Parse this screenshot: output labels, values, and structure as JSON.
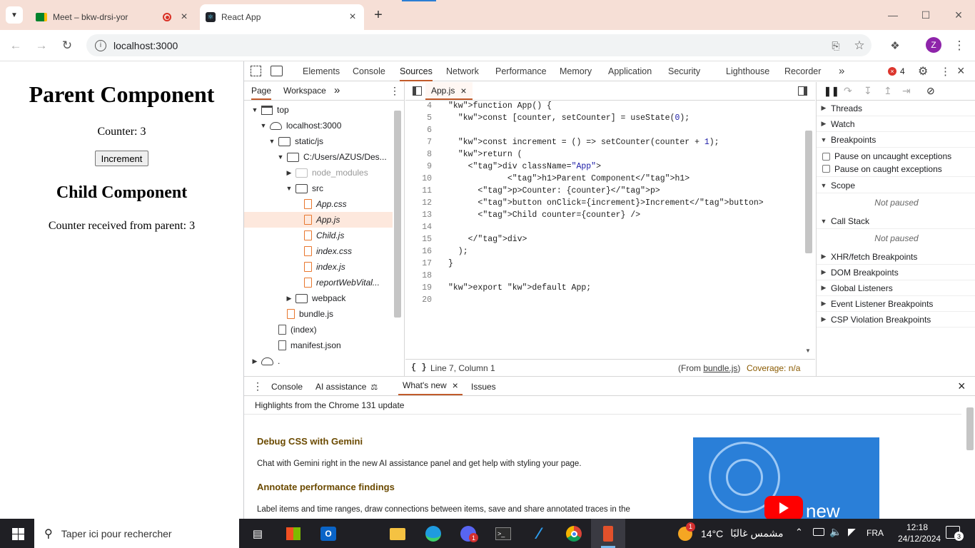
{
  "browser": {
    "tabs": [
      {
        "title": "Meet – bkw-drsi-yor",
        "icon": "google-meet-icon"
      },
      {
        "title": "React App",
        "icon": "react-icon"
      }
    ],
    "new_tab": "+",
    "url": "localhost:3000",
    "profile_initial": "Z"
  },
  "page": {
    "h1": "Parent Component",
    "counter_text": "Counter: 3",
    "button_label": "Increment",
    "h2": "Child Component",
    "child_text": "Counter received from parent: 3"
  },
  "devtools": {
    "tabs": [
      "Elements",
      "Console",
      "Sources",
      "Network",
      "Performance",
      "Memory",
      "Application",
      "Security",
      "Lighthouse",
      "Recorder"
    ],
    "active_tab": "Sources",
    "error_count": "4",
    "navigator_tabs": [
      "Page",
      "Workspace"
    ],
    "tree": [
      {
        "label": "top",
        "depth": 0,
        "kind": "frame",
        "open": true
      },
      {
        "label": "localhost:3000",
        "depth": 1,
        "kind": "cloud",
        "open": true
      },
      {
        "label": "static/js",
        "depth": 2,
        "kind": "folder",
        "open": true
      },
      {
        "label": "C:/Users/AZUS/Des...",
        "depth": 3,
        "kind": "folder",
        "open": true
      },
      {
        "label": "node_modules",
        "depth": 4,
        "kind": "folder-grey",
        "open": false
      },
      {
        "label": "src",
        "depth": 4,
        "kind": "folder",
        "open": true
      },
      {
        "label": "App.css",
        "depth": 5,
        "kind": "file-js"
      },
      {
        "label": "App.js",
        "depth": 5,
        "kind": "file-js",
        "selected": true
      },
      {
        "label": "Child.js",
        "depth": 5,
        "kind": "file-js"
      },
      {
        "label": "index.css",
        "depth": 5,
        "kind": "file-js"
      },
      {
        "label": "index.js",
        "depth": 5,
        "kind": "file-js"
      },
      {
        "label": "reportWebVital...",
        "depth": 5,
        "kind": "file-js"
      },
      {
        "label": "webpack",
        "depth": 4,
        "kind": "folder",
        "open": false
      },
      {
        "label": "bundle.js",
        "depth": 3,
        "kind": "file-js"
      },
      {
        "label": "(index)",
        "depth": 2,
        "kind": "file"
      },
      {
        "label": "manifest.json",
        "depth": 2,
        "kind": "file"
      },
      {
        "label": ".",
        "depth": 0,
        "kind": "cloud",
        "open": false
      }
    ],
    "editor": {
      "file": "App.js",
      "lines": [
        {
          "n": "4",
          "t": "function App() {"
        },
        {
          "n": "5",
          "t": "  const [counter, setCounter] = useState(0);"
        },
        {
          "n": "6",
          "t": ""
        },
        {
          "n": "7",
          "t": "  const increment = () => setCounter(counter + 1);"
        },
        {
          "n": "8",
          "t": "  return ("
        },
        {
          "n": "9",
          "t": "    <div className=\"App\">"
        },
        {
          "n": "10",
          "t": "            <h1>Parent Component</h1>"
        },
        {
          "n": "11",
          "t": "      <p>Counter: {counter}</p>"
        },
        {
          "n": "12",
          "t": "      <button onClick={increment}>Increment</button>"
        },
        {
          "n": "13",
          "t": "      <Child counter={counter} />"
        },
        {
          "n": "14",
          "t": ""
        },
        {
          "n": "15",
          "t": "    </div>"
        },
        {
          "n": "16",
          "t": "  );"
        },
        {
          "n": "17",
          "t": "}"
        },
        {
          "n": "18",
          "t": ""
        },
        {
          "n": "19",
          "t": "export default App;"
        },
        {
          "n": "20",
          "t": ""
        }
      ],
      "status": "Line 7, Column 1",
      "from_prefix": "(From ",
      "from_file": "bundle.js",
      "from_suffix": ")",
      "coverage": "Coverage: n/a"
    },
    "debugger": {
      "threads": "Threads",
      "watch": "Watch",
      "breakpoints": "Breakpoints",
      "pause_uncaught": "Pause on uncaught exceptions",
      "pause_caught": "Pause on caught exceptions",
      "scope": "Scope",
      "not_paused": "Not paused",
      "call_stack": "Call Stack",
      "xhr": "XHR/fetch Breakpoints",
      "dom": "DOM Breakpoints",
      "global": "Global Listeners",
      "event": "Event Listener Breakpoints",
      "csp": "CSP Violation Breakpoints"
    },
    "drawer": {
      "tabs": [
        "Console",
        "AI assistance",
        "What's new",
        "Issues"
      ],
      "active": "What's new",
      "highlights": "Highlights from the Chrome 131 update",
      "h1": "Debug CSS with Gemini",
      "p1": "Chat with Gemini right in the new AI assistance panel and get help with styling your page.",
      "h2": "Annotate performance findings",
      "p2": "Label items and time ranges, draw connections between items, save and share annotated traces in the",
      "video_text": "new"
    }
  },
  "taskbar": {
    "search_placeholder": "Taper ici pour rechercher",
    "weather_temp": "14°C",
    "weather_text": "مشمس غالبًا",
    "language": "FRA",
    "time": "12:18",
    "date": "24/12/2024",
    "notification_count": "3",
    "weather_badge": "1",
    "discord_badge": "1"
  },
  "colors": {
    "accent": "#c15a2a",
    "tab_strip": "#f6dfd6",
    "error": "#dc362e"
  }
}
